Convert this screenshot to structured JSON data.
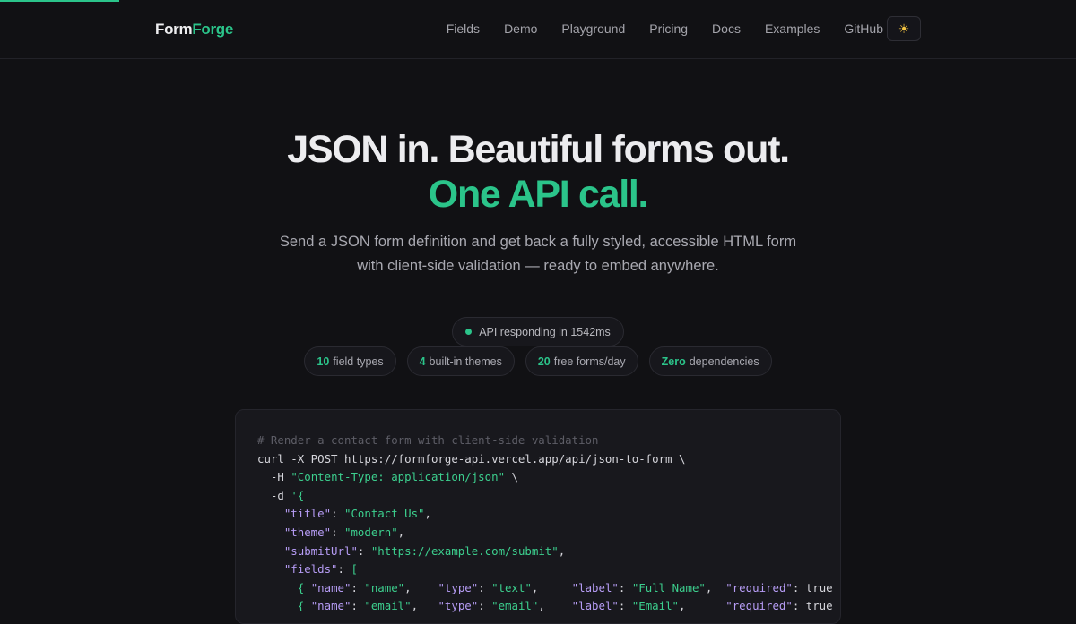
{
  "brand": {
    "part1": "Form",
    "part2": "Forge"
  },
  "nav": {
    "items": [
      "Fields",
      "Demo",
      "Playground",
      "Pricing",
      "Docs",
      "Examples",
      "GitHub"
    ],
    "theme_icon": "sun-icon",
    "theme_glyph": "☀"
  },
  "hero": {
    "title_line1": "JSON in. Beautiful forms out.",
    "title_line2": "One API call.",
    "subtitle": "Send a JSON form definition and get back a fully styled, accessible HTML form with client-side validation — ready to embed anywhere."
  },
  "status": {
    "text": "API responding in 1542ms"
  },
  "stats": [
    {
      "value": "10",
      "label": "field types"
    },
    {
      "value": "4",
      "label": "built-in themes"
    },
    {
      "value": "20",
      "label": "free forms/day"
    },
    {
      "value": "Zero",
      "label": "dependencies"
    }
  ],
  "code": {
    "comment": "# Render a contact form with client-side validation",
    "curl_prefix": "curl -X POST https://formforge-api.vercel.app/api/json-to-form \\",
    "header_flag": "  -H ",
    "header_value": "\"Content-Type: application/json\"",
    "header_suffix": " \\",
    "data_flag": "  -d ",
    "data_open": "'{",
    "title_key": "\"title\"",
    "title_value": "\"Contact Us\"",
    "theme_key": "\"theme\"",
    "theme_value": "\"modern\"",
    "submit_key": "\"submitUrl\"",
    "submit_value": "\"https://example.com/submit\"",
    "fields_key": "\"fields\"",
    "fields_open": "[",
    "f1_name_key": "\"name\"",
    "f1_name_value": "\"name\"",
    "f1_type_key": "\"type\"",
    "f1_type_value": "\"text\"",
    "f1_label_key": "\"label\"",
    "f1_label_value": "\"Full Name\"",
    "f1_req_key": "\"required\"",
    "f1_req_value": "true",
    "f2_name_key": "\"name\"",
    "f2_name_value": "\"email\"",
    "f2_type_key": "\"type\"",
    "f2_type_value": "\"email\"",
    "f2_label_key": "\"label\"",
    "f2_label_value": "\"Email\"",
    "f2_req_key": "\"required\"",
    "f2_req_value": "true"
  },
  "colors": {
    "accent": "#2bc48a",
    "background": "#111114",
    "key": "#b69cf5"
  }
}
